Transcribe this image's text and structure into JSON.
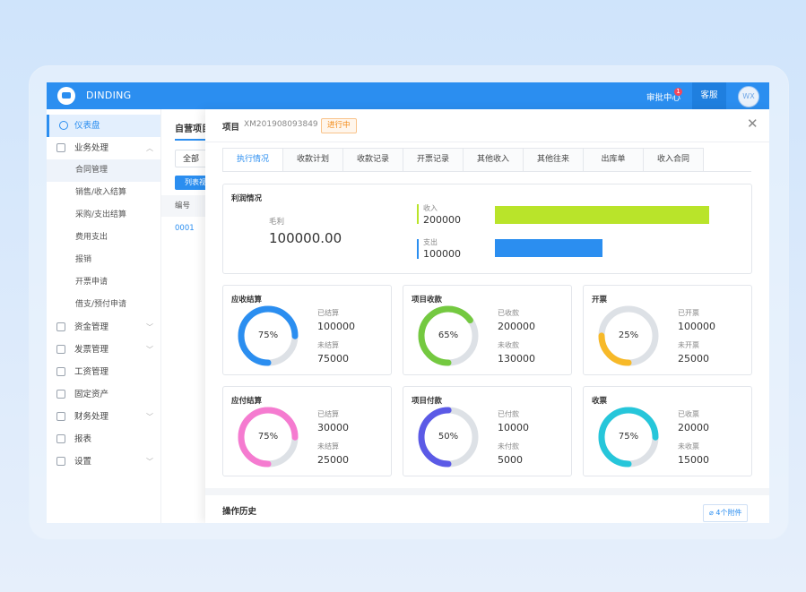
{
  "topbar": {
    "brand": "DINDING",
    "approval_label": "审批中心",
    "approval_badge": "1",
    "service_label": "客服",
    "avatar_text": "WX"
  },
  "sidebar": {
    "items": [
      {
        "label": "仪表盘",
        "level": "top",
        "icon": "dashboard-icon",
        "active": true
      },
      {
        "label": "业务处理",
        "level": "top",
        "icon": "document-icon",
        "expanded": true
      },
      {
        "label": "合同管理",
        "level": "sub",
        "selected": true
      },
      {
        "label": "销售/收入结算",
        "level": "sub"
      },
      {
        "label": "采购/支出结算",
        "level": "sub"
      },
      {
        "label": "费用支出",
        "level": "sub"
      },
      {
        "label": "报销",
        "level": "sub"
      },
      {
        "label": "开票申请",
        "level": "sub"
      },
      {
        "label": "借支/预付申请",
        "level": "sub"
      },
      {
        "label": "资金管理",
        "level": "top",
        "icon": "wallet-icon",
        "chevron": true
      },
      {
        "label": "发票管理",
        "level": "top",
        "icon": "invoice-icon",
        "chevron": true
      },
      {
        "label": "工资管理",
        "level": "top",
        "icon": "salary-icon"
      },
      {
        "label": "固定资产",
        "level": "top",
        "icon": "asset-icon"
      },
      {
        "label": "财务处理",
        "level": "top",
        "icon": "finance-icon",
        "chevron": true
      },
      {
        "label": "报表",
        "level": "top",
        "icon": "report-icon"
      },
      {
        "label": "设置",
        "level": "top",
        "icon": "settings-icon",
        "chevron": true
      }
    ]
  },
  "list_page": {
    "title": "自营项目",
    "filter_value": "全部",
    "list_button": "列表视",
    "column_header": "编号",
    "first_cell": "0001"
  },
  "drawer": {
    "label": "项目",
    "code": "XM201908093849",
    "status": "进行中",
    "tabs": [
      "执行情况",
      "收款计划",
      "收款记录",
      "开票记录",
      "其他收入",
      "其他往来",
      "出库单",
      "收入合同"
    ],
    "active_tab": 0,
    "profit": {
      "title": "利润情况",
      "gross_label": "毛利",
      "gross_value": "100000.00",
      "income_label": "收入",
      "income_value": "200000",
      "income_fraction": 1.0,
      "income_color": "#b9e42a",
      "expense_label": "支出",
      "expense_value": "100000",
      "expense_fraction": 0.5,
      "expense_color": "#2b8ef0"
    },
    "rings": [
      {
        "title": "应收结算",
        "percent": 75,
        "pct_text": "75%",
        "color": "#2b8ef0",
        "label1": "已结算",
        "value1": "100000",
        "label2": "未结算",
        "value2": "75000"
      },
      {
        "title": "项目收款",
        "percent": 65,
        "pct_text": "65%",
        "color": "#74c940",
        "label1": "已收款",
        "value1": "200000",
        "label2": "未收款",
        "value2": "130000"
      },
      {
        "title": "开票",
        "percent": 25,
        "pct_text": "25%",
        "color": "#f7b928",
        "label1": "已开票",
        "value1": "100000",
        "label2": "未开票",
        "value2": "25000"
      },
      {
        "title": "应付结算",
        "percent": 75,
        "pct_text": "75%",
        "color": "#f57bd0",
        "label1": "已结算",
        "value1": "30000",
        "label2": "未结算",
        "value2": "25000"
      },
      {
        "title": "项目付款",
        "percent": 50,
        "pct_text": "50%",
        "color": "#5b5ae6",
        "label1": "已付款",
        "value1": "10000",
        "label2": "未付款",
        "value2": "5000"
      },
      {
        "title": "收票",
        "percent": 75,
        "pct_text": "75%",
        "color": "#26c6da",
        "label1": "已收票",
        "value1": "20000",
        "label2": "未收票",
        "value2": "15000"
      }
    ],
    "history_title": "操作历史",
    "attachments_label": "4个附件"
  }
}
